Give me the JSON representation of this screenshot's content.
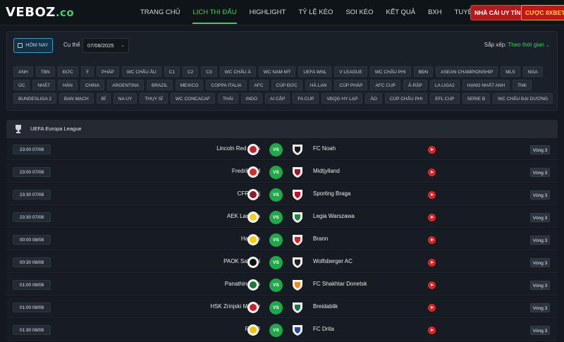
{
  "header": {
    "logo_main": "VEBOZ",
    "logo_ext": ".co",
    "nav": [
      {
        "label": "TRANG CHỦ",
        "active": false
      },
      {
        "label": "LỊCH THI ĐẤU",
        "active": true
      },
      {
        "label": "HIGHLIGHT",
        "active": false
      },
      {
        "label": "TỶ LỆ KÈO",
        "active": false
      },
      {
        "label": "SOI KÈO",
        "active": false
      },
      {
        "label": "KẾT QUẢ",
        "active": false
      },
      {
        "label": "BXH",
        "active": false
      },
      {
        "label": "TUYỂN DỤNG",
        "active": false
      }
    ],
    "cta_primary": "NHÀ CÁI UY TÍN",
    "cta_secondary": "CƯỢC 8XBET"
  },
  "filters": {
    "today_label": "HÔM NAY",
    "cuthe_label": "Cụ thể",
    "date_value": "07/08/2025",
    "sort_label": "Sắp xếp:",
    "sort_value": "Theo thời gian",
    "chips": [
      "ANH",
      "TBN",
      "ĐỨC",
      "Ý",
      "PHÁP",
      "WC CHÂU ÂU",
      "C1",
      "C2",
      "C3",
      "WC CHÂU Á",
      "WC NAM MỸ",
      "UEFA WNL",
      "V LEAGUE",
      "WC CHÂU PHI",
      "BĐN",
      "ASEAN CHAMPIONSHIP",
      "MLS",
      "NGA",
      "ÚC",
      "NHẬT",
      "HÀN",
      "CHINA",
      "ARGENTINA",
      "BRAZIL",
      "MEXICO",
      "COPPA ITALIA",
      "AFC",
      "CÚP ĐỨC",
      "HÀ LAN",
      "CÚP PHÁP",
      "AFC CUP",
      "Ả-RẬP",
      "LA LIGA2",
      "HẠNG NHẤT ANH",
      "TNK",
      "BUNDESLIGA 2",
      "ĐAN MẠCH",
      "BỈ",
      "NA UY",
      "THỤY SĨ",
      "WC CONCACAF",
      "THÁI",
      "INDO",
      "AI CẬP",
      "FA CUP",
      "VĐQG HY LẠP",
      "ÁO",
      "CÚP CHÂU PHI",
      "EFL CUP",
      "SERIE B",
      "WC CHÂU ĐẠI DƯƠNG"
    ]
  },
  "league": {
    "name": "UEFA Europa League"
  },
  "matches": [
    {
      "time": "23:00 07/08",
      "home": "Lincoln Red Imps",
      "away": "FC Noah",
      "round": "Vòng 3",
      "home_color": "#c8202a",
      "away_color": "#1a1a1a"
    },
    {
      "time": "23:00 07/08",
      "home": "Fredrikstad",
      "away": "Midtjylland",
      "round": "Vòng 3",
      "home_color": "#d42a2a",
      "away_color": "#9b1b2a"
    },
    {
      "time": "23:30 07/08",
      "home": "CFR Cluj",
      "away": "Sporting Braga",
      "round": "Vòng 3",
      "home_color": "#8a1c2c",
      "away_color": "#c8102e"
    },
    {
      "time": "23:30 07/08",
      "home": "AEK Larnaca",
      "away": "Legia Warszawa",
      "round": "Vòng 3",
      "home_color": "#f2d21b",
      "away_color": "#1f8a3a"
    },
    {
      "time": "00:00 08/08",
      "home": "Hacken",
      "away": "Brann",
      "round": "Vòng 3",
      "home_color": "#f4d000",
      "away_color": "#d8202a"
    },
    {
      "time": "00:30 08/08",
      "home": "PAOK Saloniki",
      "away": "Wolfsberger AC",
      "round": "Vòng 3",
      "home_color": "#111111",
      "away_color": "#222222"
    },
    {
      "time": "01:00 08/08",
      "home": "Panathinaikos",
      "away": "FC Shakhtar Donetsk",
      "round": "Vòng 3",
      "home_color": "#1a7a3c",
      "away_color": "#f08a1e"
    },
    {
      "time": "01:00 08/08",
      "home": "HSK Zrinjski Mostar",
      "away": "Breidablik",
      "round": "Vòng 3",
      "home_color": "#c82030",
      "away_color": "#1a7a3c"
    },
    {
      "time": "01:30 08/08",
      "home": "FCSB",
      "away": "FC Drita",
      "round": "Vòng 3",
      "home_color": "#f2c200",
      "away_color": "#2a4aa0"
    }
  ]
}
